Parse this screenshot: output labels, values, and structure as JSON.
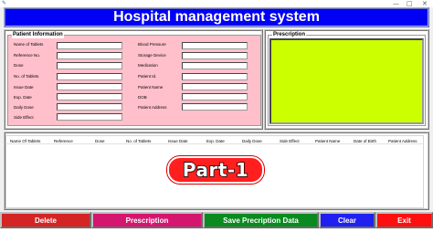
{
  "window": {
    "app_icon": "feather-icon",
    "controls": [
      "—",
      "□",
      "✕"
    ]
  },
  "banner": {
    "title": "Hospital management system"
  },
  "patient_info": {
    "legend": "Patient Information",
    "left_labels": [
      "Name of Tablets",
      "Reference No.",
      "Dose",
      "No. of Tablets",
      "Issue Date",
      "Exp. Date",
      "Daily Dose",
      "Side Effect"
    ],
    "right_labels": [
      "Blood Pressure",
      "Storage Device",
      "Medication",
      "Patient Id.",
      "Patient Name",
      "DOB",
      "Patient Address"
    ]
  },
  "prescription": {
    "legend": "Prescription",
    "text": ""
  },
  "table": {
    "columns": [
      "Name Of Tablets",
      "Reference",
      "Dose",
      "No. of Tablets",
      "Issue Date",
      "Exp. Date",
      "Daily Dose",
      "Side Effect",
      "Patient Name",
      "Date of Birth",
      "Patient Address"
    ]
  },
  "overlay": {
    "label": "Part-1"
  },
  "buttons": {
    "delete": "Delete",
    "prescription": "Prescription",
    "save": "Save Precription Data",
    "clear": "Clear",
    "exit": "Exit"
  },
  "colors": {
    "banner": "#0000f5",
    "patient_bg": "#ffc0cb",
    "prescription_bg": "#ccff00",
    "delete": "#d42424",
    "prescription_btn": "#d4166f",
    "save": "#0a8a1f",
    "clear": "#2020f0",
    "exit": "#ff1010"
  }
}
